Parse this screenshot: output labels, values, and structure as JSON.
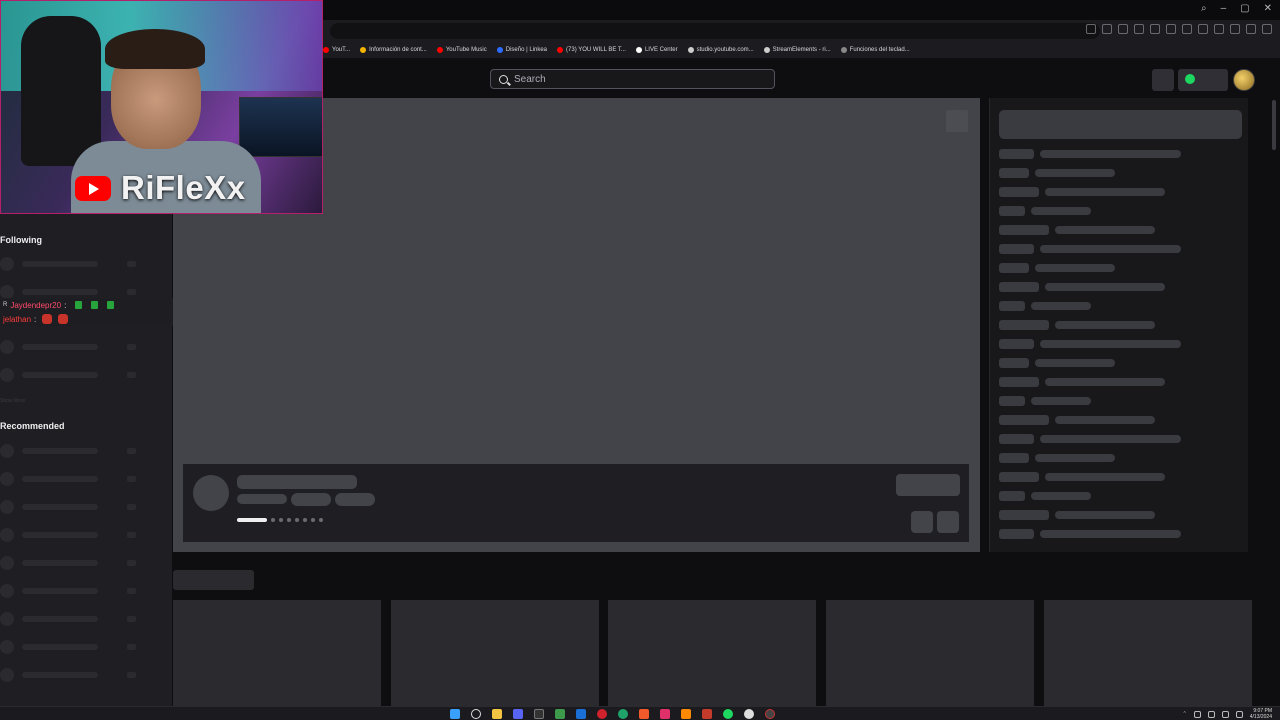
{
  "browser": {
    "bookmarks": [
      {
        "label": "YouT...",
        "color": "#ff0000"
      },
      {
        "label": "Información de cont...",
        "color": "#f4b400"
      },
      {
        "label": "YouTube Music",
        "color": "#ff0000"
      },
      {
        "label": "Diseño | Linkea",
        "color": "#2b6cff"
      },
      {
        "label": "(73) YOU WILL BE T...",
        "color": "#ff0000"
      },
      {
        "label": "LIVE Center",
        "color": "#ffffff"
      },
      {
        "label": "studio.youtube.com...",
        "color": "#cccccc"
      },
      {
        "label": "StreamElements - ri...",
        "color": "#cccccc"
      },
      {
        "label": "Funciones del teclad...",
        "color": "#888888"
      }
    ]
  },
  "header": {
    "search_placeholder": "Search"
  },
  "webcam": {
    "channel_name": "RiFleXx"
  },
  "sidebar": {
    "following_heading": "Following",
    "recommended_heading": "Recommended",
    "show_more": "Show More"
  },
  "chat": {
    "messages": [
      {
        "badge": "R",
        "user": "Jaydendepr20",
        "colon": ":"
      },
      {
        "user": "jelathan",
        "colon": ":"
      }
    ]
  },
  "taskbar": {
    "time": "9:07 PM",
    "date": "4/13/2024"
  },
  "colors": {
    "accent_online": "#1ed760",
    "youtube_red": "#ff0000",
    "skeleton": "#434449"
  }
}
